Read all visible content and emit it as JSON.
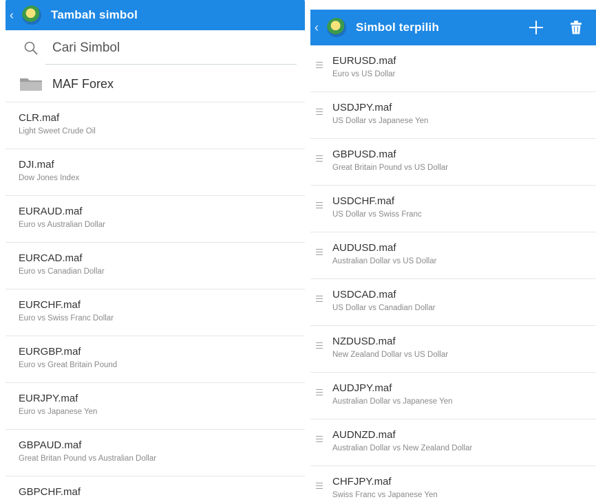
{
  "left_panel": {
    "title": "Tambah simbol",
    "search": {
      "placeholder": "Cari Simbol"
    },
    "folder_label": "MAF Forex",
    "symbols": [
      {
        "name": "CLR.maf",
        "desc": "Light Sweet Crude Oil"
      },
      {
        "name": "DJI.maf",
        "desc": "Dow Jones Index"
      },
      {
        "name": "EURAUD.maf",
        "desc": "Euro vs Australian Dollar"
      },
      {
        "name": "EURCAD.maf",
        "desc": "Euro vs Canadian Dollar"
      },
      {
        "name": "EURCHF.maf",
        "desc": "Euro vs Swiss Franc Dollar"
      },
      {
        "name": "EURGBP.maf",
        "desc": "Euro vs Great Britain Pound"
      },
      {
        "name": "EURJPY.maf",
        "desc": "Euro vs Japanese Yen"
      },
      {
        "name": "GBPAUD.maf",
        "desc": "Great Britan Pound vs Australian Dollar"
      },
      {
        "name": "GBPCHF.maf",
        "desc": ""
      }
    ]
  },
  "right_panel": {
    "title": "Simbol terpilih",
    "symbols": [
      {
        "name": "EURUSD.maf",
        "desc": "Euro vs US Dollar"
      },
      {
        "name": "USDJPY.maf",
        "desc": "US Dollar vs Japanese Yen"
      },
      {
        "name": "GBPUSD.maf",
        "desc": "Great Britain Pound vs US Dollar"
      },
      {
        "name": "USDCHF.maf",
        "desc": "US Dollar vs Swiss Franc"
      },
      {
        "name": "AUDUSD.maf",
        "desc": "Australian Dollar vs US Dollar"
      },
      {
        "name": "USDCAD.maf",
        "desc": "US Dollar vs Canadian Dollar"
      },
      {
        "name": "NZDUSD.maf",
        "desc": "New Zealand Dollar vs US Dollar"
      },
      {
        "name": "AUDJPY.maf",
        "desc": "Australian Dollar vs Japanese Yen"
      },
      {
        "name": "AUDNZD.maf",
        "desc": "Australian Dollar vs New Zealand Dollar"
      },
      {
        "name": "CHFJPY.maf",
        "desc": "Swiss Franc vs Japanese Yen"
      }
    ]
  },
  "icons": {
    "back": "chevron-left-icon",
    "logo": "app-logo-icon",
    "search": "search-icon",
    "folder": "folder-icon",
    "add": "plus-icon",
    "delete": "trash-icon",
    "drag": "drag-handle-icon"
  },
  "colors": {
    "appbar": "#1e88e5",
    "divider": "#e6e6e6",
    "text_primary": "#333333",
    "text_secondary": "#8a8a8a"
  }
}
